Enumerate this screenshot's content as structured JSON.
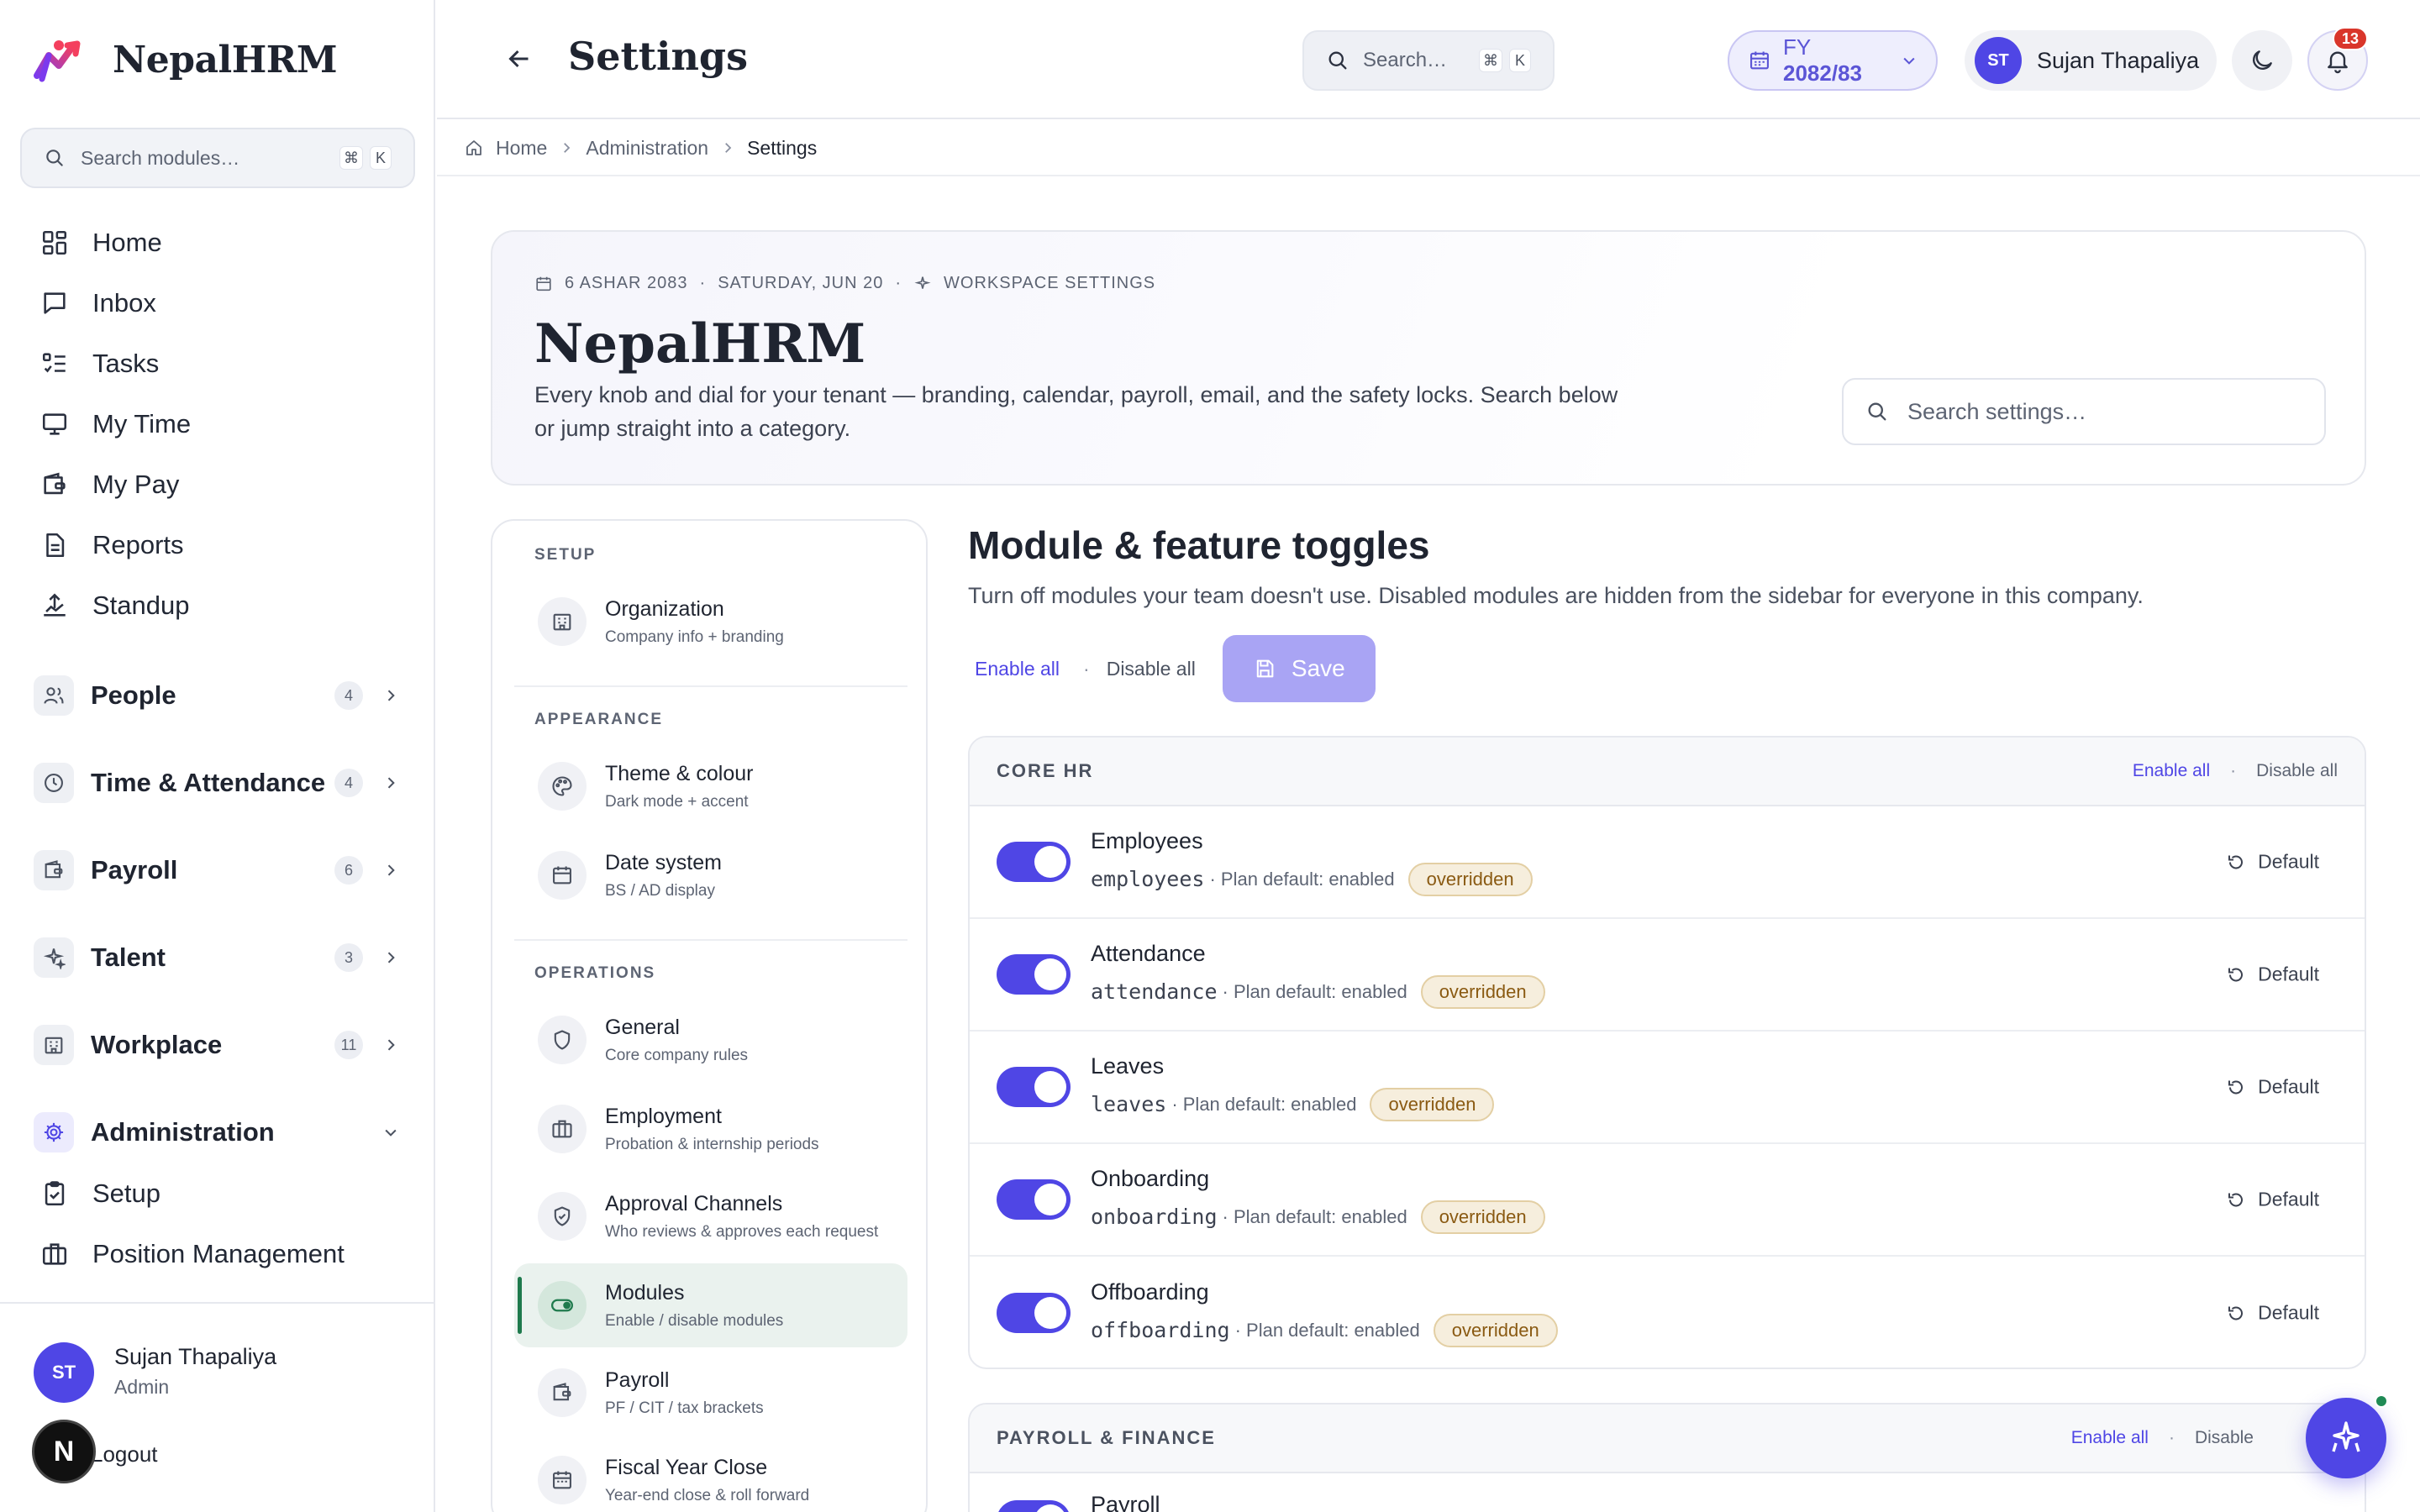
{
  "app": {
    "name": "NepalHRM",
    "accent": "#4f46e5"
  },
  "sidebar": {
    "search_placeholder": "Search modules…",
    "kbd": [
      "⌘",
      "K"
    ],
    "nav": [
      {
        "label": "Home",
        "icon": "grid-icon"
      },
      {
        "label": "Inbox",
        "icon": "message-icon"
      },
      {
        "label": "Tasks",
        "icon": "checklist-icon"
      },
      {
        "label": "My Time",
        "icon": "monitor-icon"
      },
      {
        "label": "My Pay",
        "icon": "wallet-icon"
      },
      {
        "label": "Reports",
        "icon": "document-icon"
      },
      {
        "label": "Standup",
        "icon": "standup-icon"
      }
    ],
    "groups": [
      {
        "label": "People",
        "count": "4",
        "icon": "users-icon"
      },
      {
        "label": "Time & Attendance",
        "count": "4",
        "icon": "clock-icon"
      },
      {
        "label": "Payroll",
        "count": "6",
        "icon": "wallet-icon"
      },
      {
        "label": "Talent",
        "count": "3",
        "icon": "sparkle-icon"
      },
      {
        "label": "Workplace",
        "count": "11",
        "icon": "building-icon"
      }
    ],
    "admin": {
      "label": "Administration",
      "children": [
        {
          "label": "Setup",
          "icon": "clipboard-check-icon"
        },
        {
          "label": "Position Management",
          "icon": "briefcase-icon"
        }
      ]
    },
    "user": {
      "initials": "ST",
      "name": "Sujan Thapaliya",
      "role": "Admin",
      "logout": "Logout"
    },
    "badge_letter": "N"
  },
  "topbar": {
    "title": "Settings",
    "search_placeholder": "Search…",
    "kbd": [
      "⌘",
      "K"
    ],
    "fy_prefix": "FY",
    "fy_value": "2082/83",
    "user_initials": "ST",
    "user_name": "Sujan Thapaliya",
    "notification_count": "13"
  },
  "breadcrumb": [
    "Home",
    "Administration",
    "Settings"
  ],
  "hero": {
    "date_bs": "6 ASHAR 2083",
    "date_ad": "SATURDAY, JUN 20",
    "context": "WORKSPACE SETTINGS",
    "title": "NepalHRM",
    "description": "Every knob and dial for your tenant — branding, calendar, payroll, email, and the safety locks. Search below or jump straight into a category.",
    "search_placeholder": "Search settings…"
  },
  "categories": {
    "setup_label": "SETUP",
    "appearance_label": "APPEARANCE",
    "operations_label": "OPERATIONS",
    "items": [
      {
        "title": "Organization",
        "sub": "Company info + branding",
        "icon": "building-icon"
      },
      {
        "title": "Theme & colour",
        "sub": "Dark mode + accent",
        "icon": "palette-icon"
      },
      {
        "title": "Date system",
        "sub": "BS / AD display",
        "icon": "calendar-icon"
      },
      {
        "title": "General",
        "sub": "Core company rules",
        "icon": "shield-icon"
      },
      {
        "title": "Employment",
        "sub": "Probation & internship periods",
        "icon": "briefcase-icon"
      },
      {
        "title": "Approval Channels",
        "sub": "Who reviews & approves each request",
        "icon": "shield-check-icon"
      },
      {
        "title": "Modules",
        "sub": "Enable / disable modules",
        "icon": "toggle-icon"
      },
      {
        "title": "Payroll",
        "sub": "PF / CIT / tax brackets",
        "icon": "wallet-icon"
      },
      {
        "title": "Fiscal Year Close",
        "sub": "Year-end close & roll forward",
        "icon": "calendar-icon"
      }
    ]
  },
  "main": {
    "title": "Module & feature toggles",
    "description": "Turn off modules your team doesn't use. Disabled modules are hidden from the sidebar for everyone in this company.",
    "enable_all": "Enable all",
    "separator": "·",
    "disable_all": "Disable all",
    "save": "Save",
    "default_label": "Default",
    "sections": [
      {
        "title": "CORE HR",
        "modules": [
          {
            "name": "Employees",
            "key": "employees",
            "plan": "· Plan default: enabled",
            "badge": "overridden",
            "enabled": true
          },
          {
            "name": "Attendance",
            "key": "attendance",
            "plan": "· Plan default: enabled",
            "badge": "overridden",
            "enabled": true
          },
          {
            "name": "Leaves",
            "key": "leaves",
            "plan": "· Plan default: enabled",
            "badge": "overridden",
            "enabled": true
          },
          {
            "name": "Onboarding",
            "key": "onboarding",
            "plan": "· Plan default: enabled",
            "badge": "overridden",
            "enabled": true
          },
          {
            "name": "Offboarding",
            "key": "offboarding",
            "plan": "· Plan default: enabled",
            "badge": "overridden",
            "enabled": true
          }
        ]
      },
      {
        "title": "PAYROLL & FINANCE",
        "disable_partial": "Disable",
        "modules": [
          {
            "name": "Payroll"
          }
        ]
      }
    ]
  }
}
